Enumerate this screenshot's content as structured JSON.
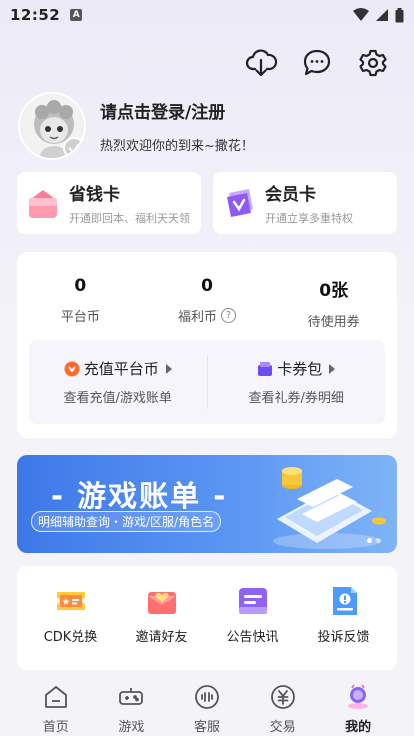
{
  "status_bar": {
    "time": "12:52",
    "indicator": "A"
  },
  "header": {
    "icons": [
      "cloud-download-icon",
      "chat-icon",
      "settings-icon"
    ]
  },
  "profile": {
    "login_text": "请点击登录/注册",
    "welcome_text": "热烈欢迎你的到来~撒花！"
  },
  "cards": [
    {
      "title": "省钱卡",
      "subtitle": "开通即回本、福利天天领",
      "icon": "savings-card-icon"
    },
    {
      "title": "会员卡",
      "subtitle": "开通立享多重特权",
      "icon": "vip-card-icon"
    }
  ],
  "wallet": {
    "stats": [
      {
        "value": "0",
        "label": "平台币"
      },
      {
        "value": "0",
        "label": "福利币"
      },
      {
        "value": "0张",
        "label": "待使用券"
      }
    ],
    "actions": [
      {
        "title": "充值平台币",
        "subtitle": "查看充值/游戏账单"
      },
      {
        "title": "卡券包",
        "subtitle": "查看礼券/券明细"
      }
    ]
  },
  "banner": {
    "title": "- 游戏账单 -",
    "subtitle": "明细辅助查询・游戏/区服/角色名",
    "accent": "#3E78E8"
  },
  "tools": [
    {
      "label": "CDK兑换",
      "icon": "ticket-icon"
    },
    {
      "label": "邀请好友",
      "icon": "invite-envelope-icon"
    },
    {
      "label": "公告快讯",
      "icon": "announcement-icon"
    },
    {
      "label": "投诉反馈",
      "icon": "feedback-icon"
    }
  ],
  "tabbar": [
    {
      "label": "首页",
      "icon": "home-icon"
    },
    {
      "label": "游戏",
      "icon": "gamepad-icon"
    },
    {
      "label": "客服",
      "icon": "customer-service-icon"
    },
    {
      "label": "交易",
      "icon": "trade-icon"
    },
    {
      "label": "我的",
      "icon": "profile-icon",
      "active": true
    }
  ]
}
